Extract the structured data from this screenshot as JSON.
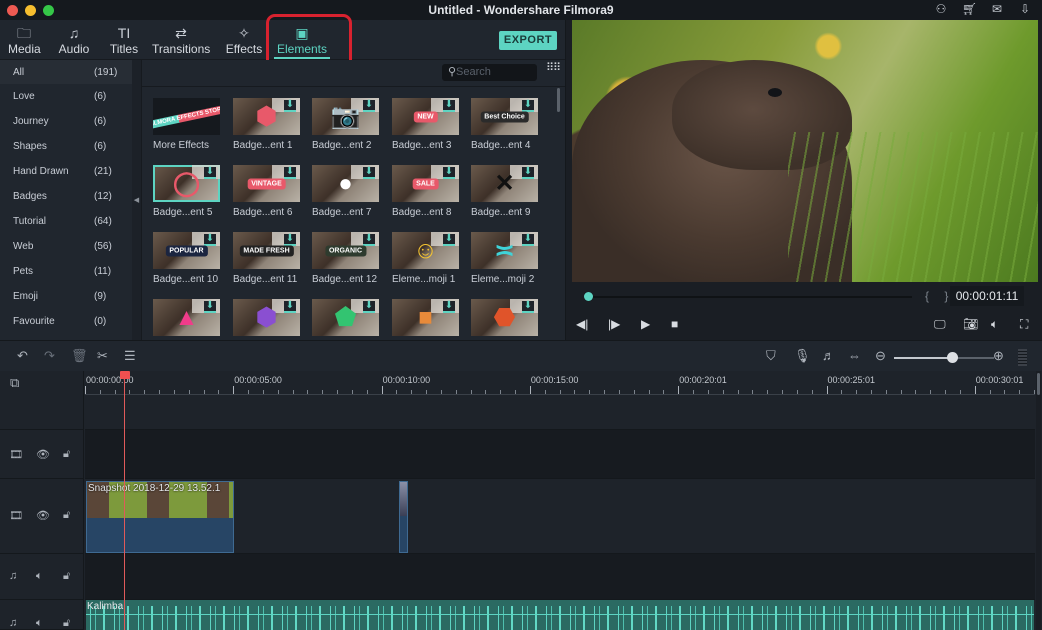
{
  "window": {
    "title": "Untitled - Wondershare Filmora9",
    "icons": [
      "account-icon",
      "cart-icon",
      "mail-icon",
      "download-icon"
    ]
  },
  "library": {
    "tabs": [
      {
        "label": "Media",
        "icon": "folder-icon",
        "glyph": "🗀"
      },
      {
        "label": "Audio",
        "icon": "music-note-icon",
        "glyph": "♫"
      },
      {
        "label": "Titles",
        "icon": "title-text-icon",
        "glyph": "TI"
      },
      {
        "label": "Transitions",
        "icon": "transitions-icon",
        "glyph": "⇄"
      },
      {
        "label": "Effects",
        "icon": "effects-icon",
        "glyph": "✧"
      },
      {
        "label": "Elements",
        "icon": "elements-image-icon",
        "glyph": "▣",
        "active": true
      }
    ],
    "export_label": "EXPORT",
    "search_placeholder": "Search",
    "categories": [
      {
        "name": "All",
        "count": "(191)",
        "active": true
      },
      {
        "name": "Love",
        "count": "(6)"
      },
      {
        "name": "Journey",
        "count": "(6)"
      },
      {
        "name": "Shapes",
        "count": "(6)"
      },
      {
        "name": "Hand Drawn",
        "count": "(21)"
      },
      {
        "name": "Badges",
        "count": "(12)"
      },
      {
        "name": "Tutorial",
        "count": "(64)"
      },
      {
        "name": "Web",
        "count": "(56)"
      },
      {
        "name": "Pets",
        "count": "(11)"
      },
      {
        "name": "Emoji",
        "count": "(9)"
      },
      {
        "name": "Favourite",
        "count": "(0)"
      }
    ],
    "items": [
      {
        "label": "More Effects",
        "badge": "FILMORA EFFECTS STORE",
        "badge_color": "#e8596a"
      },
      {
        "label": "Badge...ent 1",
        "badge": "⬢",
        "badge_color": "#e8596a"
      },
      {
        "label": "Badge...ent 2",
        "badge": "📷",
        "badge_color": "#ffffff"
      },
      {
        "label": "Badge...ent 3",
        "badge": "NEW",
        "badge_color": "#e8596a"
      },
      {
        "label": "Badge...ent 4",
        "badge": "Best Choice",
        "badge_color": "#2b2b2b"
      },
      {
        "label": "Badge...ent 5",
        "badge": "◯",
        "badge_color": "#e8596a",
        "selected": true
      },
      {
        "label": "Badge...ent 6",
        "badge": "VINTAGE",
        "badge_color": "#e8596a"
      },
      {
        "label": "Badge...ent 7",
        "badge": "●",
        "badge_color": "#ffffff"
      },
      {
        "label": "Badge...ent 8",
        "badge": "SALE",
        "badge_color": "#e8596a"
      },
      {
        "label": "Badge...ent 9",
        "badge": "✕",
        "badge_color": "#111111"
      },
      {
        "label": "Badge...ent 10",
        "badge": "POPULAR",
        "badge_color": "#1b2540"
      },
      {
        "label": "Badge...ent 11",
        "badge": "MADE FRESH",
        "badge_color": "#222222"
      },
      {
        "label": "Badge...ent 12",
        "badge": "ORGANIC",
        "badge_color": "#2e3b2e"
      },
      {
        "label": "Eleme...moji 1",
        "badge": "☺",
        "badge_color": "#f5c431"
      },
      {
        "label": "Eleme...moji 2",
        "badge": "≍",
        "badge_color": "#3fd3d8"
      },
      {
        "label": "",
        "badge": "▲",
        "badge_color": "#f03c8a"
      },
      {
        "label": "",
        "badge": "⬢",
        "badge_color": "#8a4fd1"
      },
      {
        "label": "",
        "badge": "⬟",
        "badge_color": "#33c471"
      },
      {
        "label": "",
        "badge": "■",
        "badge_color": "#e78a3a"
      },
      {
        "label": "",
        "badge": "⬣",
        "badge_color": "#e0542a"
      }
    ]
  },
  "preview": {
    "timecode": "00:00:01:11",
    "progress_fraction": 0.0,
    "braces": "{ }",
    "controls": [
      {
        "name": "prev-frame-button",
        "icon": "step-back-icon",
        "glyph": "◀|"
      },
      {
        "name": "play-frame-button",
        "icon": "step-forward-icon",
        "glyph": "|▶"
      },
      {
        "name": "play-button",
        "icon": "play-icon",
        "glyph": "▶"
      },
      {
        "name": "stop-button",
        "icon": "stop-icon",
        "glyph": "■"
      }
    ],
    "right_controls": [
      {
        "name": "render-settings-button",
        "icon": "screen-settings-icon",
        "glyph": "🖵"
      },
      {
        "name": "snapshot-button",
        "icon": "camera-icon",
        "glyph": "📷"
      },
      {
        "name": "volume-button",
        "icon": "speaker-icon",
        "glyph": "🔈"
      },
      {
        "name": "fullscreen-button",
        "icon": "fullscreen-icon",
        "glyph": "⛶"
      }
    ]
  },
  "timeline_toolbar": {
    "left": [
      {
        "name": "undo-button",
        "icon": "undo-icon",
        "glyph": "↶",
        "dim": false
      },
      {
        "name": "redo-button",
        "icon": "redo-icon",
        "glyph": "↷",
        "dim": true
      },
      {
        "name": "delete-button",
        "icon": "trash-icon",
        "glyph": "🗑",
        "dim": true
      },
      {
        "name": "cut-button",
        "icon": "scissors-icon",
        "glyph": "✂",
        "dim": false
      },
      {
        "name": "adjust-button",
        "icon": "sliders-icon",
        "glyph": "☰",
        "dim": false
      }
    ],
    "right": [
      {
        "name": "marker-button",
        "icon": "marker-icon",
        "glyph": "⛉"
      },
      {
        "name": "record-voice-button",
        "icon": "microphone-icon",
        "glyph": "🎙"
      },
      {
        "name": "audio-mixer-button",
        "icon": "audio-mixer-icon",
        "glyph": "♬"
      },
      {
        "name": "fit-timeline-button",
        "icon": "fit-width-icon",
        "glyph": "⇔"
      },
      {
        "name": "zoom-out-button",
        "icon": "zoom-out-icon",
        "glyph": "⊖"
      },
      {
        "name": "zoom-in-button",
        "icon": "zoom-in-icon",
        "glyph": "⊕"
      }
    ],
    "zoom_level_fraction": 0.58
  },
  "timeline": {
    "add_track_icon": "add-track-icon",
    "ruler": [
      "00:00:00:00",
      "00:00:05:00",
      "00:00:10:00",
      "00:00:15:00",
      "00:00:20:01",
      "00:00:25:01",
      "00:00:30:01"
    ],
    "clips": {
      "video": "Snapshot 2018-12-29 13.52.1",
      "audio": "Kalimba"
    }
  }
}
